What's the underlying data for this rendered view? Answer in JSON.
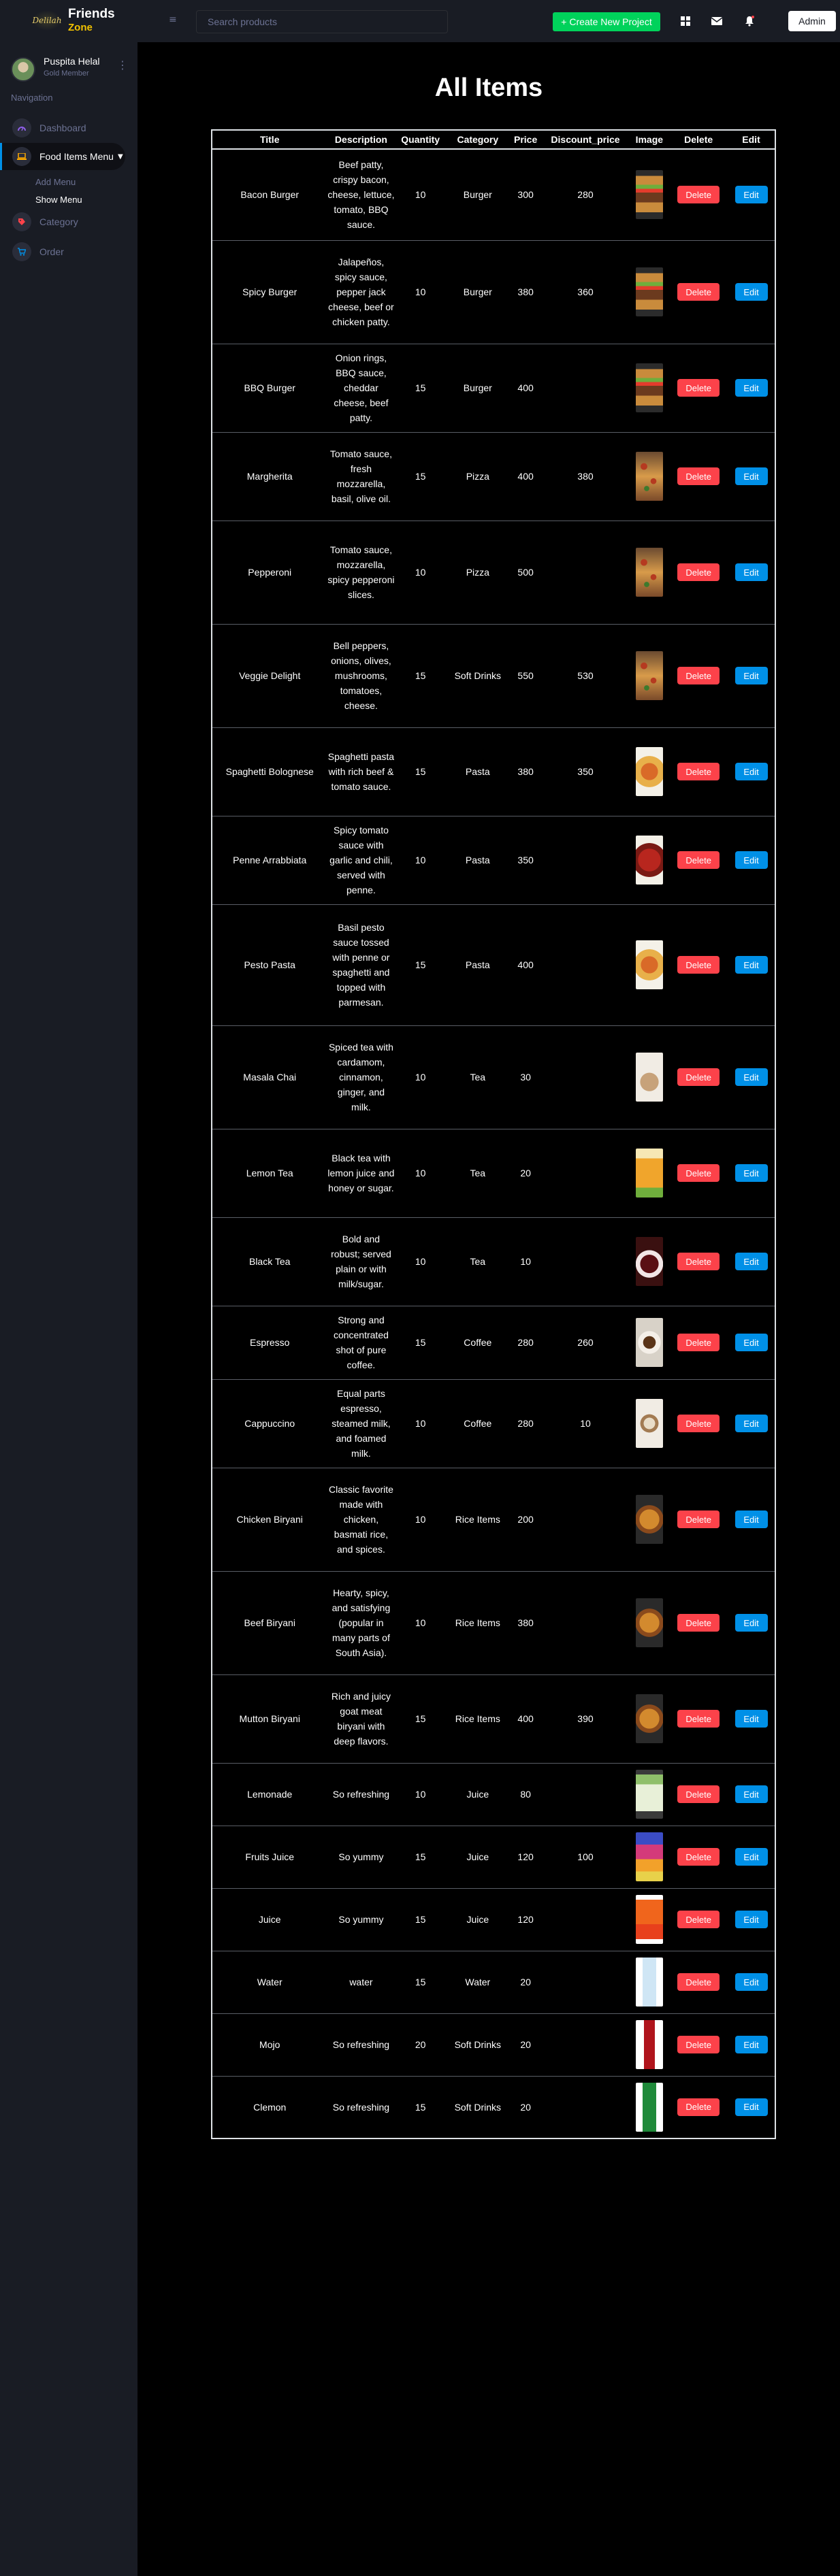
{
  "brand": {
    "logo_text": "Delilah",
    "title": "Friends",
    "subtitle": "Zone"
  },
  "topbar": {
    "search_placeholder": "Search products",
    "create_label": "+ Create New Project",
    "admin_label": "Admin",
    "accent": "#00d25b"
  },
  "profile": {
    "name": "Puspita Helal",
    "role": "Gold Member"
  },
  "sidebar": {
    "heading": "Navigation",
    "items": [
      {
        "label": "Dashboard",
        "icon": "speedometer-icon"
      },
      {
        "label": "Food Items Menu",
        "icon": "laptop-icon"
      },
      {
        "label": "Category",
        "icon": "tag-icon"
      },
      {
        "label": "Order",
        "icon": "cart-icon"
      }
    ],
    "submenu": [
      "Add Menu",
      "Show Menu"
    ]
  },
  "main": {
    "title": "All Items"
  },
  "table": {
    "headers": [
      "Title",
      "Description",
      "Quantity",
      "Category",
      "Price",
      "Discount_price",
      "Image",
      "Delete",
      "Edit"
    ],
    "delete_label": "Delete",
    "edit_label": "Edit",
    "rows": [
      {
        "title": "Bacon Burger",
        "description": "Beef patty, crispy bacon, cheese, lettuce, tomato, BBQ sauce.",
        "quantity": "10",
        "category": "Burger",
        "price": "300",
        "discount": "280",
        "image": "burger"
      },
      {
        "title": "Spicy Burger",
        "description": "Jalapeños, spicy sauce, pepper jack cheese, beef or chicken patty.",
        "quantity": "10",
        "category": "Burger",
        "price": "380",
        "discount": "360",
        "image": "burger"
      },
      {
        "title": "BBQ Burger",
        "description": "Onion rings, BBQ sauce, cheddar cheese, beef patty.",
        "quantity": "15",
        "category": "Burger",
        "price": "400",
        "discount": "",
        "image": "burger"
      },
      {
        "title": "Margherita",
        "description": "Tomato sauce, fresh mozzarella, basil, olive oil.",
        "quantity": "15",
        "category": "Pizza",
        "price": "400",
        "discount": "380",
        "image": "pizza"
      },
      {
        "title": "Pepperoni",
        "description": "Tomato sauce, mozzarella, spicy pepperoni slices.",
        "quantity": "10",
        "category": "Pizza",
        "price": "500",
        "discount": "",
        "image": "pizza"
      },
      {
        "title": "Veggie Delight",
        "description": "Bell peppers, onions, olives, mushrooms, tomatoes, cheese.",
        "quantity": "15",
        "category": "Soft Drinks",
        "price": "550",
        "discount": "530",
        "image": "pizza"
      },
      {
        "title": "Spaghetti Bolognese",
        "description": "Spaghetti pasta with rich beef & tomato sauce.",
        "quantity": "15",
        "category": "Pasta",
        "price": "380",
        "discount": "350",
        "image": "pasta"
      },
      {
        "title": "Penne Arrabbiata",
        "description": "Spicy tomato sauce with garlic and chili, served with penne.",
        "quantity": "10",
        "category": "Pasta",
        "price": "350",
        "discount": "",
        "image": "pasta-red"
      },
      {
        "title": "Pesto Pasta",
        "description": "Basil pesto sauce tossed with penne or spaghetti and topped with parmesan.",
        "quantity": "15",
        "category": "Pasta",
        "price": "400",
        "discount": "",
        "image": "pasta"
      },
      {
        "title": "Masala Chai",
        "description": "Spiced tea with cardamom, cinnamon, ginger, and milk.",
        "quantity": "10",
        "category": "Tea",
        "price": "30",
        "discount": "",
        "image": "chai"
      },
      {
        "title": "Lemon Tea",
        "description": "Black tea with lemon juice and honey or sugar.",
        "quantity": "10",
        "category": "Tea",
        "price": "20",
        "discount": "",
        "image": "lemon-tea"
      },
      {
        "title": "Black Tea",
        "description": "Bold and robust; served plain or with milk/sugar.",
        "quantity": "10",
        "category": "Tea",
        "price": "10",
        "discount": "",
        "image": "black-tea"
      },
      {
        "title": "Espresso",
        "description": "Strong and concentrated shot of pure coffee.",
        "quantity": "15",
        "category": "Coffee",
        "price": "280",
        "discount": "260",
        "image": "espresso"
      },
      {
        "title": "Cappuccino",
        "description": "Equal parts espresso, steamed milk, and foamed milk.",
        "quantity": "10",
        "category": "Coffee",
        "price": "280",
        "discount": "10",
        "image": "cappuccino"
      },
      {
        "title": "Chicken Biryani",
        "description": "Classic favorite made with chicken, basmati rice, and spices.",
        "quantity": "10",
        "category": "Rice Items",
        "price": "200",
        "discount": "",
        "image": "biryani"
      },
      {
        "title": "Beef Biryani",
        "description": "Hearty, spicy, and satisfying (popular in many parts of South Asia).",
        "quantity": "10",
        "category": "Rice Items",
        "price": "380",
        "discount": "",
        "image": "biryani"
      },
      {
        "title": "Mutton Biryani",
        "description": "Rich and juicy goat meat biryani with deep flavors.",
        "quantity": "15",
        "category": "Rice Items",
        "price": "400",
        "discount": "390",
        "image": "biryani"
      },
      {
        "title": "Lemonade",
        "description": "So refreshing",
        "quantity": "10",
        "category": "Juice",
        "price": "80",
        "discount": "",
        "image": "lemonade"
      },
      {
        "title": "Fruits Juice",
        "description": "So yummy",
        "quantity": "15",
        "category": "Juice",
        "price": "120",
        "discount": "100",
        "image": "fruit-juice"
      },
      {
        "title": "Juice",
        "description": "So yummy",
        "quantity": "15",
        "category": "Juice",
        "price": "120",
        "discount": "",
        "image": "juice"
      },
      {
        "title": "Water",
        "description": "water",
        "quantity": "15",
        "category": "Water",
        "price": "20",
        "discount": "",
        "image": "water"
      },
      {
        "title": "Mojo",
        "description": "So refreshing",
        "quantity": "20",
        "category": "Soft Drinks",
        "price": "20",
        "discount": "",
        "image": "cola"
      },
      {
        "title": "Clemon",
        "description": "So refreshing",
        "quantity": "15",
        "category": "Soft Drinks",
        "price": "20",
        "discount": "",
        "image": "clemon"
      }
    ]
  },
  "colors": {
    "background": "#000000",
    "sidebar": "#191c24",
    "delete": "#fc424a",
    "edit": "#0090e7",
    "brand_sub": "#f2c200"
  }
}
